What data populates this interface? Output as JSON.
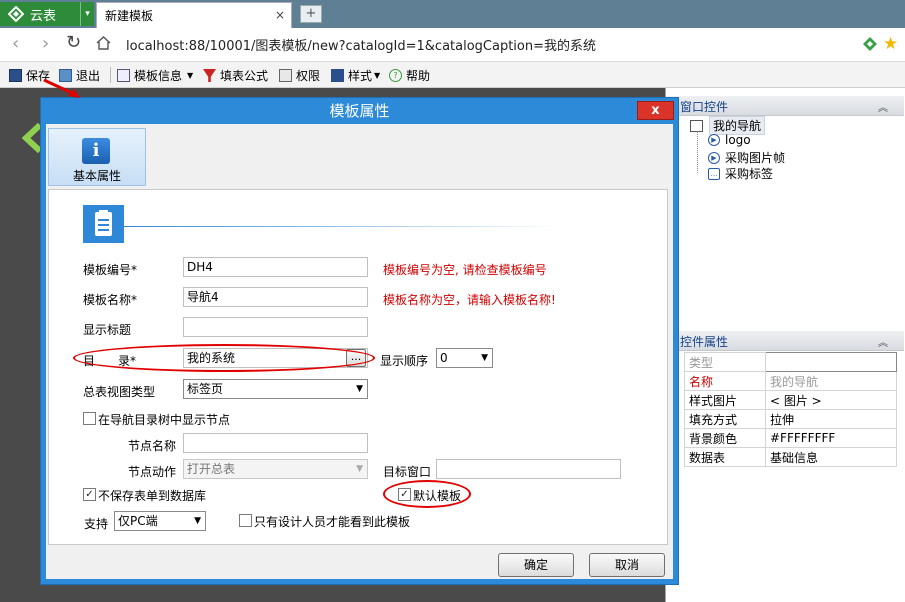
{
  "browser": {
    "app_tab_label": "云表",
    "active_tab_label": "新建模板",
    "tab_close": "×",
    "url": "localhost:88/10001/图表模板/new?catalogId=1&catalogCaption=我的系统"
  },
  "toolbar": {
    "save": "保存",
    "exit": "退出",
    "template_info": "模板信息",
    "fill_formula": "填表公式",
    "permission": "权限",
    "style": "样式",
    "help": "帮助"
  },
  "right_panel": {
    "controls_header": "窗口控件",
    "tree_root": "我的导航",
    "tree_children": [
      "logo",
      "采购图片帧",
      "采购标签"
    ],
    "props_header": "控件属性",
    "props": [
      {
        "name": "类型",
        "value": ""
      },
      {
        "name": "名称",
        "value": "我的导航"
      },
      {
        "name": "样式图片",
        "value": "< 图片 >"
      },
      {
        "name": "填充方式",
        "value": "拉伸"
      },
      {
        "name": "背景颜色",
        "value": "#FFFFFFFF"
      },
      {
        "name": "数据表",
        "value": "基础信息"
      }
    ]
  },
  "dialog": {
    "title": "模板属性",
    "close": "x",
    "nav_tile_label": "基本属性",
    "nav_icon_glyph": "i",
    "template_code_label": "模板编号*",
    "template_code_value": "DH4",
    "template_code_error": "模板编号为空, 请检查模板编号",
    "template_name_label": "模板名称*",
    "template_name_value": "导航4",
    "template_name_error": "模板名称为空，请输入模板名称!",
    "display_title_label": "显示标题",
    "display_title_value": "",
    "catalog_label_a": "目",
    "catalog_label_b": "录*",
    "catalog_value": "我的系统",
    "browse_button": "...",
    "display_order_label": "显示顺序",
    "display_order_value": "0",
    "view_type_label": "总表视图类型",
    "view_type_value": "标签页",
    "show_in_nav_label": "在导航目录树中显示节点",
    "node_name_label": "节点名称",
    "node_name_value": "",
    "node_action_label": "节点动作",
    "node_action_value": "打开总表",
    "target_window_label": "目标窗口",
    "target_window_value": "",
    "no_save_label": "不保存表单到数据库",
    "default_template_label": "默认模板",
    "support_label": "支持",
    "support_value": "仅PC端",
    "designer_only_label": "只有设计人员才能看到此模板",
    "ok_button": "确定",
    "cancel_button": "取消"
  },
  "checkbox_state": {
    "show_in_nav": false,
    "no_save": true,
    "default_template": true,
    "designer_only": false
  },
  "colors": {
    "dialog_blue": "#2d8ad8",
    "error_red": "#d40000",
    "highlight_red": "#e00000",
    "app_green": "#2e8b3a"
  }
}
